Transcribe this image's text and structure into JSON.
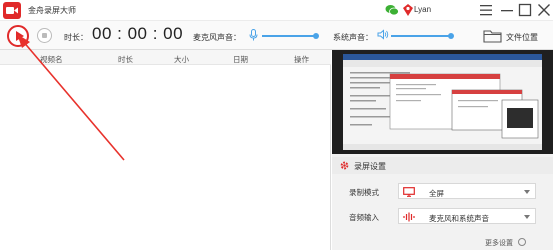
{
  "app": {
    "title": "金舟录屏大师",
    "user_name": "Lyan",
    "icons": [
      "app-logo-icon",
      "wechat-icon",
      "user-icon",
      "menu-icon",
      "minimize-icon",
      "maximize-icon",
      "close-icon"
    ]
  },
  "controls": {
    "duration_label": "时长：",
    "duration_value": "00 : 00 : 00",
    "mic_label": "麦克风声音：",
    "system_label": "系统声音：",
    "folder_label": "文件位置"
  },
  "table": {
    "columns": [
      "视频名",
      "时长",
      "大小",
      "日期",
      "操作"
    ],
    "rows": []
  },
  "settings": {
    "title": "录屏设置",
    "record_mode_label": "录制模式",
    "record_mode_value": "全屏",
    "audio_input_label": "音频输入",
    "audio_input_value": "麦克风和系统声音",
    "more_label": "更多设置"
  },
  "colors": {
    "accent_red": "#e02a2a",
    "slider_blue": "#4aa3e8"
  }
}
